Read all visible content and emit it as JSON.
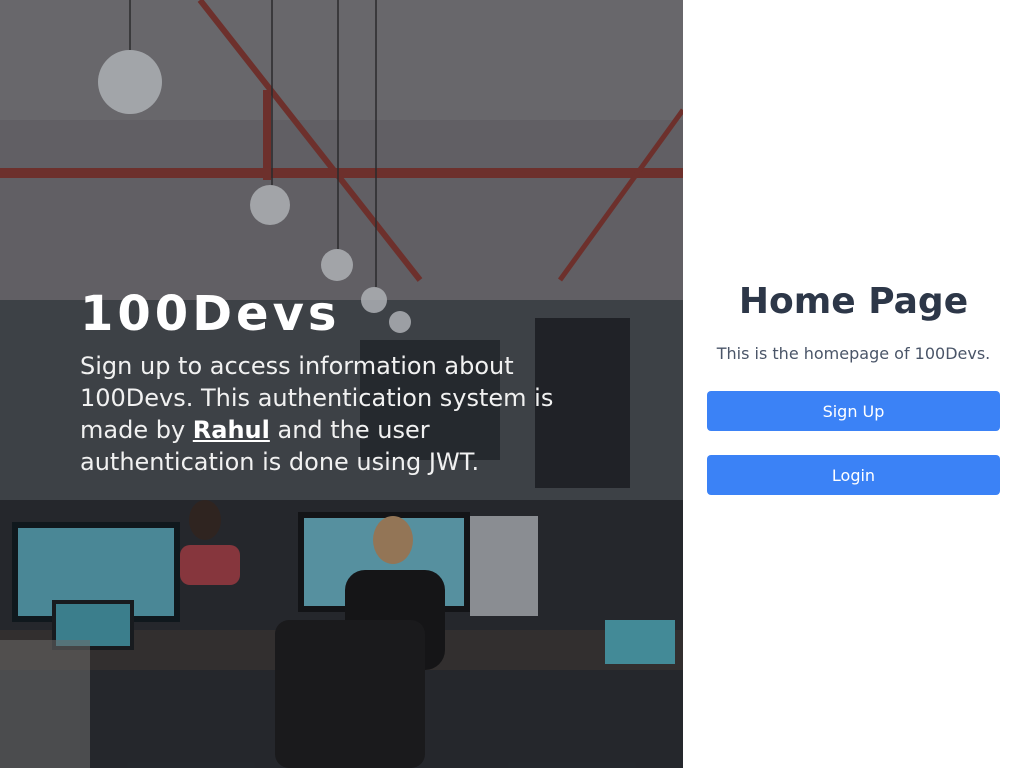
{
  "hero": {
    "brand": "100Devs",
    "desc_before_link": "Sign up to access information about 100Devs. This authentication system is made by ",
    "author_link": "Rahul",
    "desc_after_link": " and the user authentication is done using JWT.",
    "background_image": "office-workspace-photo"
  },
  "panel": {
    "title": "Home Page",
    "subtitle": "This is the homepage of 100Devs.",
    "signup_label": "Sign Up",
    "login_label": "Login"
  },
  "colors": {
    "button_bg": "#3b82f6",
    "title_text": "#2d3748",
    "subtitle_text": "#4a5568"
  }
}
